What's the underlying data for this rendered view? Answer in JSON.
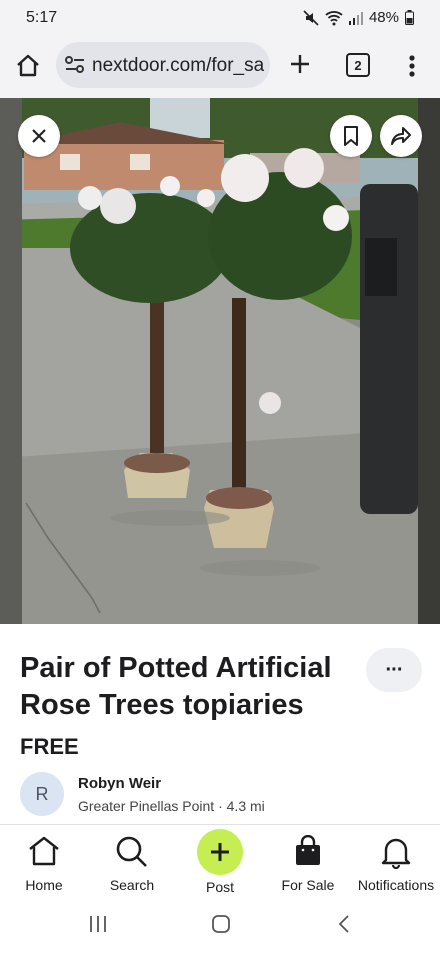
{
  "status_bar": {
    "time": "5:17",
    "battery": "48%"
  },
  "browser": {
    "url": "nextdoor.com/for_sale",
    "tab_count": "2",
    "icons": [
      "home-icon",
      "tune-icon",
      "plus-icon",
      "tabs-icon",
      "more-vertical-icon"
    ]
  },
  "photo": {
    "icons": [
      "close-icon",
      "bookmark-icon",
      "share-icon"
    ]
  },
  "listing": {
    "title": "Pair of Potted Artificial Rose Trees topiaries",
    "price": "FREE",
    "more_label": "···",
    "seller": {
      "initial": "R",
      "name": "Robyn Weir",
      "neighborhood": "Greater Pinellas Point",
      "separator": "·",
      "distance": "4.3 mi"
    }
  },
  "tab_bar": {
    "items": [
      {
        "label": "Home",
        "icon": "house-icon"
      },
      {
        "label": "Search",
        "icon": "search-icon"
      },
      {
        "label": "Post",
        "icon": "plus-icon"
      },
      {
        "label": "For Sale",
        "icon": "shopping-bag-icon"
      },
      {
        "label": "Notifications",
        "icon": "bell-icon"
      }
    ],
    "post_color": "#c6ee52"
  }
}
